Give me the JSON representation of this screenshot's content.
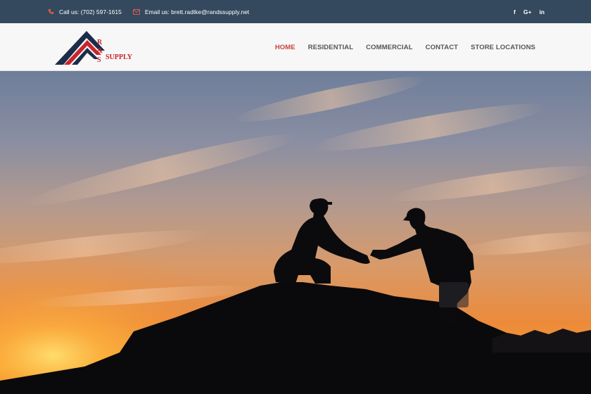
{
  "topbar": {
    "phone_label": "Call us: (702) 597-1615",
    "email_label": "Email us: brett.radtke@randssupply.net",
    "social": [
      "f",
      "G+",
      "in"
    ],
    "colors": {
      "background": "#34495e",
      "icon_accent": "#e05a4a"
    }
  },
  "brand": {
    "logo_letters": [
      "R",
      "&",
      "S"
    ],
    "logo_word": "SUPPLY",
    "colors": {
      "navy": "#1c2d4a",
      "red": "#c8252c"
    }
  },
  "nav": {
    "items": [
      "HOME",
      "RESIDENTIAL",
      "COMMERCIAL",
      "CONTACT",
      "STORE LOCATIONS"
    ],
    "active": "HOME",
    "colors": {
      "active": "#c8403c",
      "default": "#555555"
    }
  },
  "hero": {
    "image_subject": "two silhouetted roofers shaking hands on a rooftop at sunset"
  }
}
